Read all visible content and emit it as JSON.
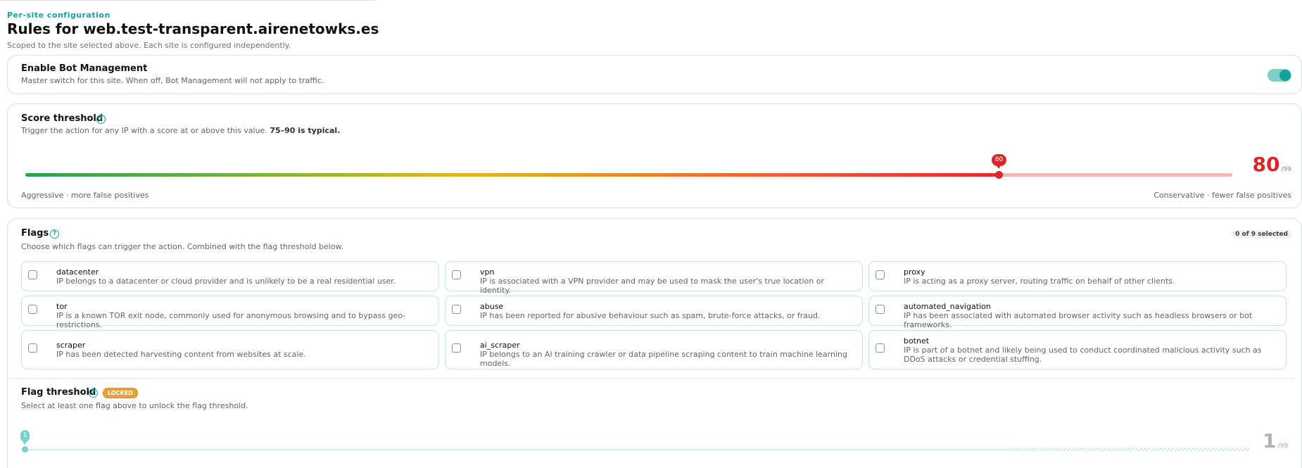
{
  "header": {
    "eyebrow": "Per-site configuration",
    "title": "Rules for web.test-transparent.airenetowks.es",
    "subtitle": "Scoped to the site selected above. Each site is configured independently."
  },
  "bot_management": {
    "title": "Enable Bot Management",
    "description": "Master switch for this site. When off, Bot Management will not apply to traffic.",
    "enabled": true
  },
  "score_threshold": {
    "title": "Score threshold",
    "description": "Trigger the action for any IP with a score at or above this value.",
    "description_bold": "75–90 is typical.",
    "value": 80,
    "tooltip": "80",
    "display_value": "80",
    "max_label": "/99",
    "min": 1,
    "max": 99,
    "left_label": "Aggressive · more false positives",
    "right_label": "Conservative · fewer false positives",
    "colors": {
      "accent": "#d9262a",
      "track_empty": "#f5b7b5"
    }
  },
  "flags": {
    "title": "Flags",
    "description": "Choose which flags can trigger the action. Combined with the flag threshold below.",
    "selected_badge": "0 of 9 selected",
    "items": [
      {
        "name": "datacenter",
        "description": "IP belongs to a datacenter or cloud provider and is unlikely to be a real residential user.",
        "checked": false
      },
      {
        "name": "vpn",
        "description": "IP is associated with a VPN provider and may be used to mask the user's true location or identity.",
        "checked": false
      },
      {
        "name": "proxy",
        "description": "IP is acting as a proxy server, routing traffic on behalf of other clients.",
        "checked": false
      },
      {
        "name": "tor",
        "description": "IP is a known TOR exit node, commonly used for anonymous browsing and to bypass geo-restrictions.",
        "checked": false
      },
      {
        "name": "abuse",
        "description": "IP has been reported for abusive behaviour such as spam, brute-force attacks, or fraud.",
        "checked": false
      },
      {
        "name": "automated_navigation",
        "description": "IP has been associated with automated browser activity such as headless browsers or bot frameworks.",
        "checked": false
      },
      {
        "name": "scraper",
        "description": "IP has been detected harvesting content from websites at scale.",
        "checked": false
      },
      {
        "name": "ai_scraper",
        "description": "IP belongs to an AI training crawler or data pipeline scraping content to train machine learning models.",
        "checked": false
      },
      {
        "name": "botnet",
        "description": "IP is part of a botnet and likely being used to conduct coordinated malicious activity such as DDoS attacks or credential stuffing.",
        "checked": false
      }
    ]
  },
  "flag_threshold": {
    "title": "Flag threshold",
    "locked_label": "LOCKED",
    "description": "Select at least one flag above to unlock the flag threshold.",
    "value": 1,
    "tooltip": "1",
    "display_value": "1",
    "max_label": "/99",
    "colors": {
      "accent": "#7cd0ca"
    }
  }
}
